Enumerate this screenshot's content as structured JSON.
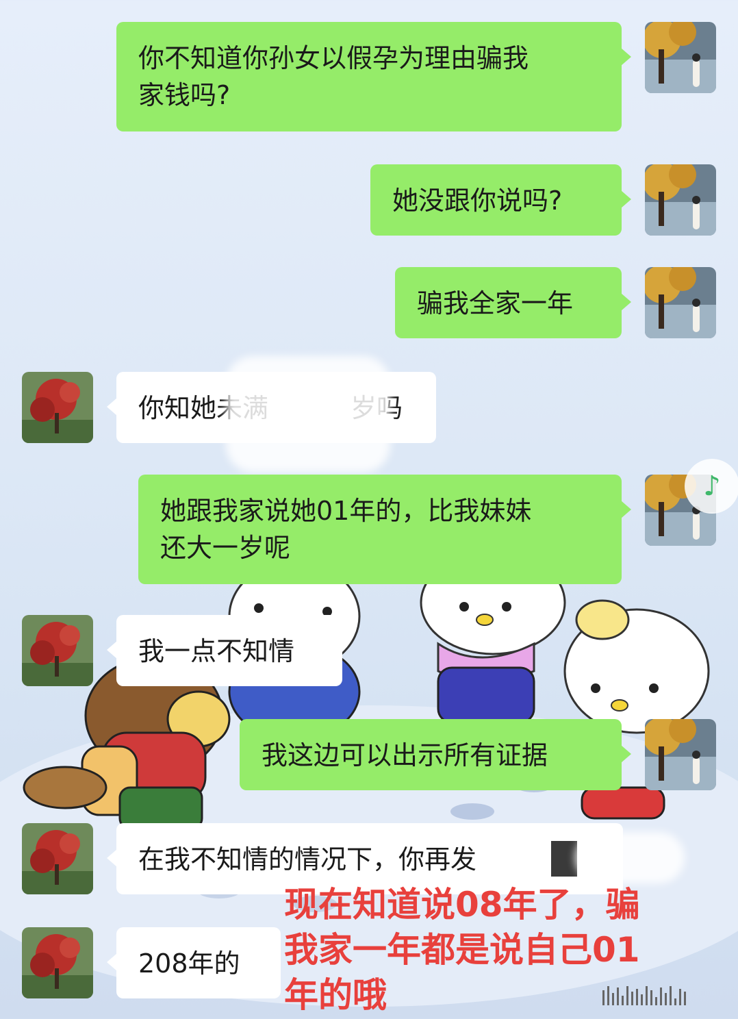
{
  "messages": [
    {
      "side": "me",
      "text": "你不知道你孙女以假孕为理由骗我\n家钱吗?"
    },
    {
      "side": "me",
      "text": "她没跟你说吗?"
    },
    {
      "side": "me",
      "text": "骗我全家一年"
    },
    {
      "side": "them",
      "text": "你知她未满"
    },
    {
      "side": "them",
      "text": "岁吗"
    },
    {
      "side": "me",
      "text": "她跟我家说她01年的，比我妹妹\n还大一岁呢"
    },
    {
      "side": "them",
      "text": "我一点不知情"
    },
    {
      "side": "me",
      "text": "我这边可以出示所有证据"
    },
    {
      "side": "them",
      "text": "在我不知情的情况下，你再发"
    },
    {
      "side": "them",
      "text": "208年的"
    }
  ],
  "caption": "现在知道说08年了，骗\n我家一年都是说自己01\n年的哦",
  "icons": {
    "music": "music-note-icon",
    "self_avatar": "avatar-woman-autumn",
    "other_avatar": "avatar-red-maple"
  },
  "colors": {
    "bubble_me": "#95ec69",
    "bubble_them": "#ffffff",
    "caption": "#e8403c"
  }
}
